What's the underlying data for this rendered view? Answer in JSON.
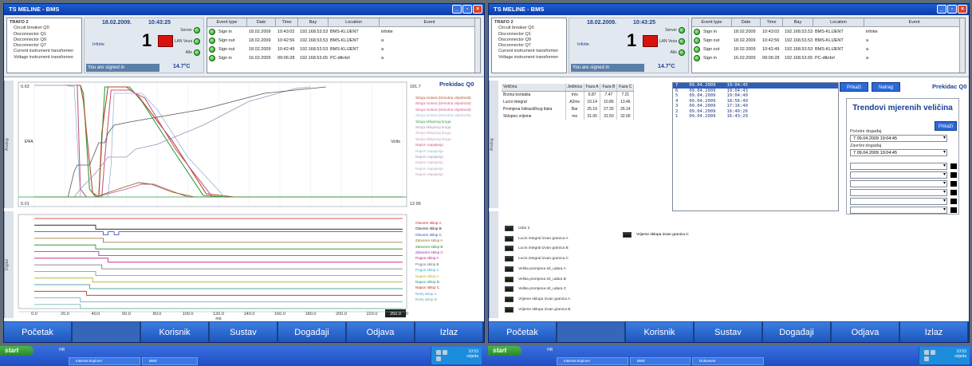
{
  "windows": [
    {
      "title": "TS MELINE - BMS",
      "tree": {
        "root": "TRAFO 2",
        "items": [
          "Circuit breaker Q0",
          "Disconnector Q1",
          "Disconnector Q9",
          "Disconnector Q7",
          "Current instrument transformer",
          "Voltage instrument transformer"
        ]
      },
      "station": {
        "date": "18.02.2009.",
        "time": "10:43:25",
        "count": "1",
        "substation": "Infotie",
        "status_labels": [
          "Server",
          "LAN Veza",
          "Alle"
        ],
        "signed_in": "You are signed in",
        "temperature": "14.7°C"
      },
      "events": {
        "headers": [
          "Event type",
          "Date",
          "Time",
          "Bay",
          "Location",
          "Event"
        ],
        "rows": [
          {
            "type": "Sign in",
            "date": "18.02.2009",
            "time": "10:43:02",
            "bay": "192.168.53.53",
            "location": "BMS-KLIJENT",
            "event": "infotie"
          },
          {
            "type": "Sign out",
            "date": "18.02.2009",
            "time": "10:42:56",
            "bay": "192.168.53.53",
            "location": "BMS-KLIJENT",
            "event": "a"
          },
          {
            "type": "Sign out",
            "date": "18.02.2009",
            "time": "10:42:49",
            "bay": "192.168.53.53",
            "location": "BMS-KLIJENT",
            "event": "a"
          },
          {
            "type": "Sign in",
            "date": "16.02.2009",
            "time": "09:06:28",
            "bay": "192.168.53.65",
            "location": "PC-dtkrbrl",
            "event": "a"
          }
        ]
      },
      "nav": [
        "Početak",
        "",
        "Korisnik",
        "Sustav",
        "Događaji",
        "Odjava",
        "Izlaz"
      ]
    },
    {
      "title": "TS MELINE - BMS",
      "tree": {
        "root": "TRAFO 2",
        "items": [
          "Circuit breaker Q0",
          "Disconnector Q1",
          "Disconnector Q9",
          "Disconnector Q7",
          "Current instrument transformer",
          "Voltage instrument transformer"
        ]
      },
      "station": {
        "date": "18.02.2009.",
        "time": "10:43:25",
        "count": "1",
        "substation": "Infotie",
        "status_labels": [
          "Server",
          "LAN Veza",
          "Alle"
        ],
        "signed_in": "You are signed in",
        "temperature": "14.7°C"
      },
      "events": {
        "headers": [
          "Event type",
          "Date",
          "Time",
          "Bay",
          "Location",
          "Event"
        ],
        "rows": [
          {
            "type": "Sign in",
            "date": "18.02.2009",
            "time": "10:43:02",
            "bay": "192.168.53.53",
            "location": "BMS-KLIJENT",
            "event": "infotie"
          },
          {
            "type": "Sign out",
            "date": "18.02.2009",
            "time": "10:42:56",
            "bay": "192.168.53.53",
            "location": "BMS-KLIJENT",
            "event": "a"
          },
          {
            "type": "Sign out",
            "date": "18.02.2009",
            "time": "10:42:49",
            "bay": "192.168.53.53",
            "location": "BMS-KLIJENT",
            "event": "a"
          },
          {
            "type": "Sign in",
            "date": "16.02.2009",
            "time": "09:06:28",
            "bay": "192.168.53.65",
            "location": "PC-dtkrbrl",
            "event": "a"
          }
        ]
      },
      "nav": [
        "Početak",
        "",
        "Korisnik",
        "Sustav",
        "Događaji",
        "Odjava",
        "Izlaz"
      ]
    }
  ],
  "left_panel": {
    "title": "Prekidac Q0",
    "tab_top": "Analog",
    "tab_bottom": "Digital",
    "ylabel_left": "Ð¥A",
    "ylabel_right": "Volts",
    "y_top_left": "0.63",
    "y_bot_left": "0.01",
    "y_top_right": "181.7",
    "y_bot_right": "12.96",
    "analog_legend": [
      {
        "text": "Struja motora (trenutna vrijednost)",
        "color": "#b54b2a"
      },
      {
        "text": "Struja motora (trenutna vrijednost)",
        "color": "#c85a82"
      },
      {
        "text": "Struja motora (trenutna vrijednost)",
        "color": "#c85a82"
      },
      {
        "text": "Struja motora (trenutna vrijednost)",
        "color": "#9bb8d4"
      },
      {
        "text": "Struja sklopnog kruga",
        "color": "#2f9d45"
      },
      {
        "text": "Struja sklopnog kruga",
        "color": "#a08fb8"
      },
      {
        "text": "Struja sklopnog kruga",
        "color": "#cfa0c0"
      },
      {
        "text": "Struja sklopnog kruga",
        "color": "#c0a0b0"
      },
      {
        "text": "Napon napajanja",
        "color": "#c85a82"
      },
      {
        "text": "Napon napajanja",
        "color": "#9bb8d4"
      },
      {
        "text": "Napon napajanja",
        "color": "#a08fb8"
      },
      {
        "text": "Napon napajanja",
        "color": "#cfa0c0"
      },
      {
        "text": "Napon napajanja",
        "color": "#9bb8d4"
      },
      {
        "text": "Napon napajanja",
        "color": "#c0a0b0"
      }
    ],
    "digital_legend": [
      {
        "text": "Otvoren sklop A",
        "color": "#d21b1b"
      },
      {
        "text": "Otvoren sklop B",
        "color": "#111111"
      },
      {
        "text": "Otvoren sklop C",
        "color": "#2846b8"
      },
      {
        "text": "Zatvoren sklop A",
        "color": "#8a6a2a"
      },
      {
        "text": "Zatvoren sklop B",
        "color": "#1f8a22"
      },
      {
        "text": "Zatvoren sklop C",
        "color": "#a01fb0"
      },
      {
        "text": "Pogon sklop A",
        "color": "#c2157d"
      },
      {
        "text": "Pogon sklop B",
        "color": "#6a6a6a"
      },
      {
        "text": "Pogon sklop C",
        "color": "#2ab0c0"
      },
      {
        "text": "Napon sklop A",
        "color": "#b0b01a"
      },
      {
        "text": "Napon sklop B",
        "color": "#1a8a8a"
      },
      {
        "text": "Napon sklop C",
        "color": "#b52a1a"
      },
      {
        "text": "Relej sklop A",
        "color": "#5fa0d0"
      },
      {
        "text": "Relej sklop B",
        "color": "#5fb0a0"
      }
    ],
    "x_ticks": [
      "0.0",
      "20.0",
      "40.0",
      "60.0",
      "80.0",
      "100.0",
      "120.0",
      "140.0",
      "160.0",
      "180.0",
      "200.0",
      "220.0",
      "240.0"
    ],
    "x_unit": "ms",
    "x_end_box": "250.0"
  },
  "right_panel": {
    "title": "Prekidac Q0",
    "tab": "Analog",
    "table": {
      "headers": [
        "Veličina",
        "Jedinica",
        "Faza A",
        "Faza B",
        "Faza C"
      ],
      "rows": [
        [
          "Brzina kontakta",
          "m/s",
          "6.87",
          "7.47",
          "7.21"
        ],
        [
          "Lucni integral",
          "A2ms",
          "10.14",
          "10.86",
          "13.46"
        ],
        [
          "Promjena hidrauličkog tlaka",
          "Bar",
          "25.19",
          "27.35",
          "26.14"
        ],
        [
          "Sklopno vrijeme",
          "ms",
          "31.00",
          "31.50",
          "32.00"
        ]
      ]
    },
    "dates": [
      {
        "n": "7",
        "date": "09.04.2009",
        "time": "19:04:45",
        "selected": true
      },
      {
        "n": "6",
        "date": "09.04.2009",
        "time": "19:04:43",
        "selected": false
      },
      {
        "n": "5",
        "date": "09.04.2009",
        "time": "19:04:40",
        "selected": false
      },
      {
        "n": "4",
        "date": "09.04.2009",
        "time": "18:56:40",
        "selected": false
      },
      {
        "n": "3",
        "date": "09.04.2009",
        "time": "17:16:40",
        "selected": false
      },
      {
        "n": "2",
        "date": "09.04.2009",
        "time": "16:40:26",
        "selected": false
      },
      {
        "n": "1",
        "date": "09.04.2009",
        "time": "16:43:20",
        "selected": false
      }
    ],
    "btn_show": "Prikaži",
    "btn_back": "Natrag",
    "trend_title": "Trendovi mjerenih veličina",
    "btn_show2": "Prikaži",
    "start_label": "Početni događaj",
    "start_value": "7   09.04.2009    19:04:45",
    "end_label": "Završni događaj",
    "end_value": "7   09.04.2009    19:04:45",
    "signals": [
      "Udar 2",
      "Lucni integral izvan granica A",
      "Lucni integral izvan granica B",
      "Lucni integral izvan granica C",
      "Velika promjena s/t_udara A",
      "Velika promjena s/t_udara B",
      "Velika promjena s/t_udara C",
      "Vrijeme sklopa izvan granica A",
      "Vrijeme sklopa izvan granica B"
    ],
    "signal_right": "Vrijeme sklopa izvan granica C"
  },
  "taskbar": {
    "start": "start",
    "hr": "HR",
    "items_left": [
      "Internet Explorer",
      "BMS"
    ],
    "items_right": [
      "Internet Explorer",
      "BMS",
      "Dokument"
    ],
    "time": "10:53",
    "day": "srijeda"
  }
}
